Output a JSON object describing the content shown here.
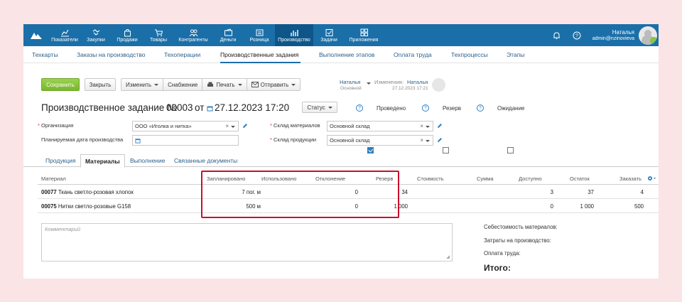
{
  "topnav": {
    "items": [
      {
        "label": "Показатели",
        "icon": "chart-icon"
      },
      {
        "label": "Закупки",
        "icon": "handshake-icon"
      },
      {
        "label": "Продажи",
        "icon": "bag-icon"
      },
      {
        "label": "Товары",
        "icon": "cart-icon"
      },
      {
        "label": "Контрагенты",
        "icon": "contacts-icon"
      },
      {
        "label": "Деньги",
        "icon": "money-icon"
      },
      {
        "label": "Розница",
        "icon": "register-icon"
      },
      {
        "label": "Производство",
        "icon": "production-icon",
        "active": true
      },
      {
        "label": "Задачи",
        "icon": "tasks-icon"
      },
      {
        "label": "Приложения",
        "icon": "apps-icon"
      }
    ],
    "user_name": "Наталья",
    "user_email": "admin@nzinovieva"
  },
  "subnav": [
    "Техкарты",
    "Заказы на производство",
    "Техоперации",
    "Производственные задания",
    "Выполнение этапов",
    "Оплата труда",
    "Техпроцессы",
    "Этапы"
  ],
  "toolbar": {
    "save": "Сохранить",
    "close": "Закрыть",
    "edit": "Изменить",
    "supply": "Снабжение",
    "print": "Печать",
    "send": "Отправить"
  },
  "owner": {
    "name": "Наталья",
    "role": "Основной",
    "changes_label": "Изменения:",
    "changes_by": "Наталья",
    "changes_at": "27.12.2023 17:21"
  },
  "doc": {
    "title": "Производственное задание №",
    "number": "00003",
    "from": "от",
    "date": "27.12.2023 17:20",
    "status": "Статус",
    "conducted": "Проведено",
    "reserve": "Резерв",
    "waiting": "Ожидание"
  },
  "form": {
    "org_label": "Организация",
    "org_value": "ООО «Иголка и нитка»",
    "plan_date_label": "Планируемая дата производства",
    "materials_wh_label": "Склад материалов",
    "materials_wh_value": "Основной склад",
    "products_wh_label": "Склад продукции",
    "products_wh_value": "Основной склад"
  },
  "tabs": [
    "Продукция",
    "Материалы",
    "Выполнение",
    "Связанные документы"
  ],
  "table": {
    "headers": {
      "material": "Материал",
      "planned": "Запланировано",
      "used": "Использовано",
      "deviation": "Отклонение",
      "reserve": "Резерв",
      "cost": "Стоимость",
      "sum": "Сумма",
      "available": "Доступно",
      "stock": "Остаток",
      "order": "Заказать"
    },
    "rows": [
      {
        "code": "00077",
        "name": "Ткань светло-розовая хлопок",
        "planned": "7 пог. м",
        "used": "",
        "deviation": "0",
        "reserve": "34",
        "cost": "",
        "sum": "",
        "available": "3",
        "stock": "37",
        "order": "4"
      },
      {
        "code": "00075",
        "name": "Нитки светло-розовые G158",
        "planned": "500 м",
        "used": "",
        "deviation": "0",
        "reserve": "1 000",
        "cost": "",
        "sum": "",
        "available": "0",
        "stock": "1 000",
        "order": "500"
      }
    ]
  },
  "comment_placeholder": "Комментарий",
  "summary": {
    "materials_cost": "Себестоимость материалов:",
    "production_cost": "Затраты на производство:",
    "labor": "Оплата труда:",
    "total": "Итого:"
  }
}
